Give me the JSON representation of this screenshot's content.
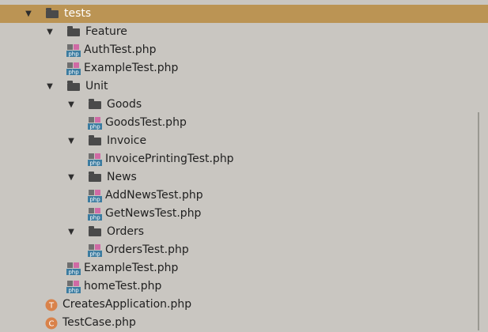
{
  "tree": [
    {
      "label": "tests",
      "type": "folder",
      "expanded": true,
      "selected": true,
      "depth": 0,
      "icon": "folder-icon"
    },
    {
      "label": "Feature",
      "type": "folder",
      "expanded": true,
      "depth": 1,
      "icon": "folder-icon"
    },
    {
      "label": "AuthTest.php",
      "type": "php",
      "depth": 2,
      "icon": "php-file-icon"
    },
    {
      "label": "ExampleTest.php",
      "type": "php",
      "depth": 2,
      "icon": "php-file-icon"
    },
    {
      "label": "Unit",
      "type": "folder",
      "expanded": true,
      "depth": 1,
      "icon": "folder-icon"
    },
    {
      "label": "Goods",
      "type": "folder",
      "expanded": true,
      "depth": 2,
      "icon": "folder-icon"
    },
    {
      "label": "GoodsTest.php",
      "type": "php",
      "depth": 3,
      "icon": "php-file-icon"
    },
    {
      "label": "Invoice",
      "type": "folder",
      "expanded": true,
      "depth": 2,
      "icon": "folder-icon"
    },
    {
      "label": "InvoicePrintingTest.php",
      "type": "php",
      "depth": 3,
      "icon": "php-file-icon"
    },
    {
      "label": "News",
      "type": "folder",
      "expanded": true,
      "depth": 2,
      "icon": "folder-icon"
    },
    {
      "label": "AddNewsTest.php",
      "type": "php",
      "depth": 3,
      "icon": "php-file-icon"
    },
    {
      "label": "GetNewsTest.php",
      "type": "php",
      "depth": 3,
      "icon": "php-file-icon"
    },
    {
      "label": "Orders",
      "type": "folder",
      "expanded": true,
      "depth": 2,
      "icon": "folder-icon"
    },
    {
      "label": "OrdersTest.php",
      "type": "php",
      "depth": 3,
      "icon": "php-file-icon"
    },
    {
      "label": "ExampleTest.php",
      "type": "php",
      "depth": 2,
      "icon": "php-file-icon"
    },
    {
      "label": "homeTest.php",
      "type": "php",
      "depth": 2,
      "icon": "php-file-icon"
    },
    {
      "label": "CreatesApplication.php",
      "type": "trait",
      "depth": 1,
      "icon": "trait-icon"
    },
    {
      "label": "TestCase.php",
      "type": "class",
      "depth": 1,
      "icon": "class-icon"
    }
  ],
  "arrow_expanded": "▼",
  "colors": {
    "background": "#c9c6c1",
    "selection": "#bb9454",
    "folder": "#4a4a4a",
    "php_badge": "#3c7ca0",
    "class_icon": "#d9824a"
  }
}
